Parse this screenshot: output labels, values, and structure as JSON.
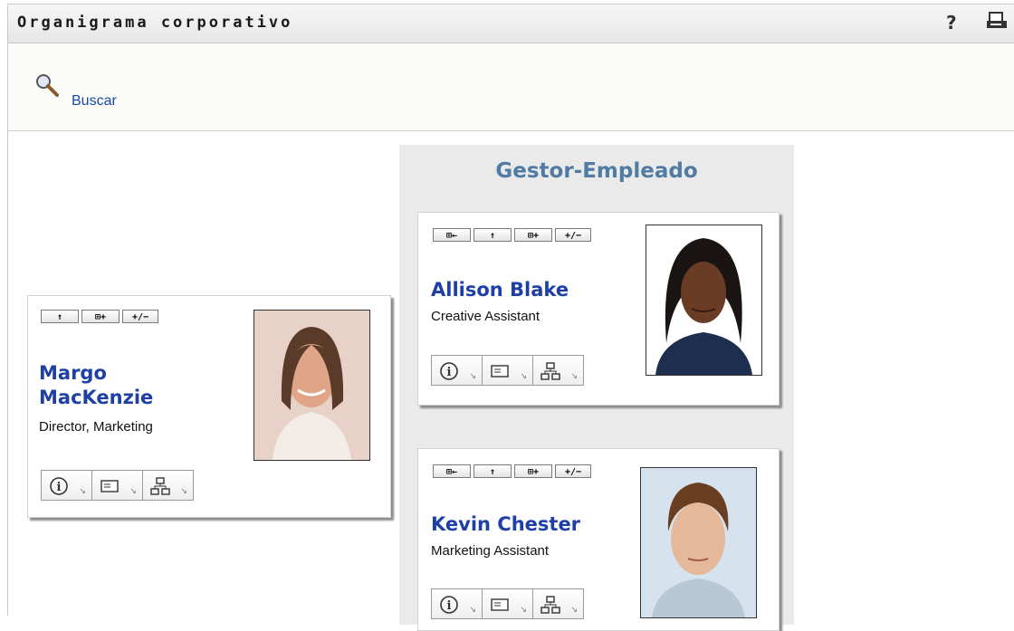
{
  "header": {
    "title": "Organigrama corporativo",
    "help_symbol": "?",
    "print_icon": "printer-icon"
  },
  "toolbar": {
    "search_label": "Buscar",
    "search_icon": "magnifier-icon"
  },
  "column": {
    "title": "Gestor-Empleado"
  },
  "cards": {
    "margo": {
      "name_line1": "Margo",
      "name_line2": "MacKenzie",
      "title": "Director, Marketing",
      "buttons": [
        "↑",
        "⊞+",
        "+/−"
      ]
    },
    "allison": {
      "name": "Allison Blake",
      "title": "Creative Assistant",
      "buttons": [
        "⊞←",
        "↑",
        "⊞+",
        "+/−"
      ]
    },
    "kevin": {
      "name": "Kevin Chester",
      "title": "Marketing Assistant",
      "buttons": [
        "⊞←",
        "↑",
        "⊞+",
        "+/−"
      ]
    }
  },
  "colors": {
    "name": "#1d3fa6",
    "column_title": "#4f7ba4",
    "link": "#1a4aa8"
  }
}
